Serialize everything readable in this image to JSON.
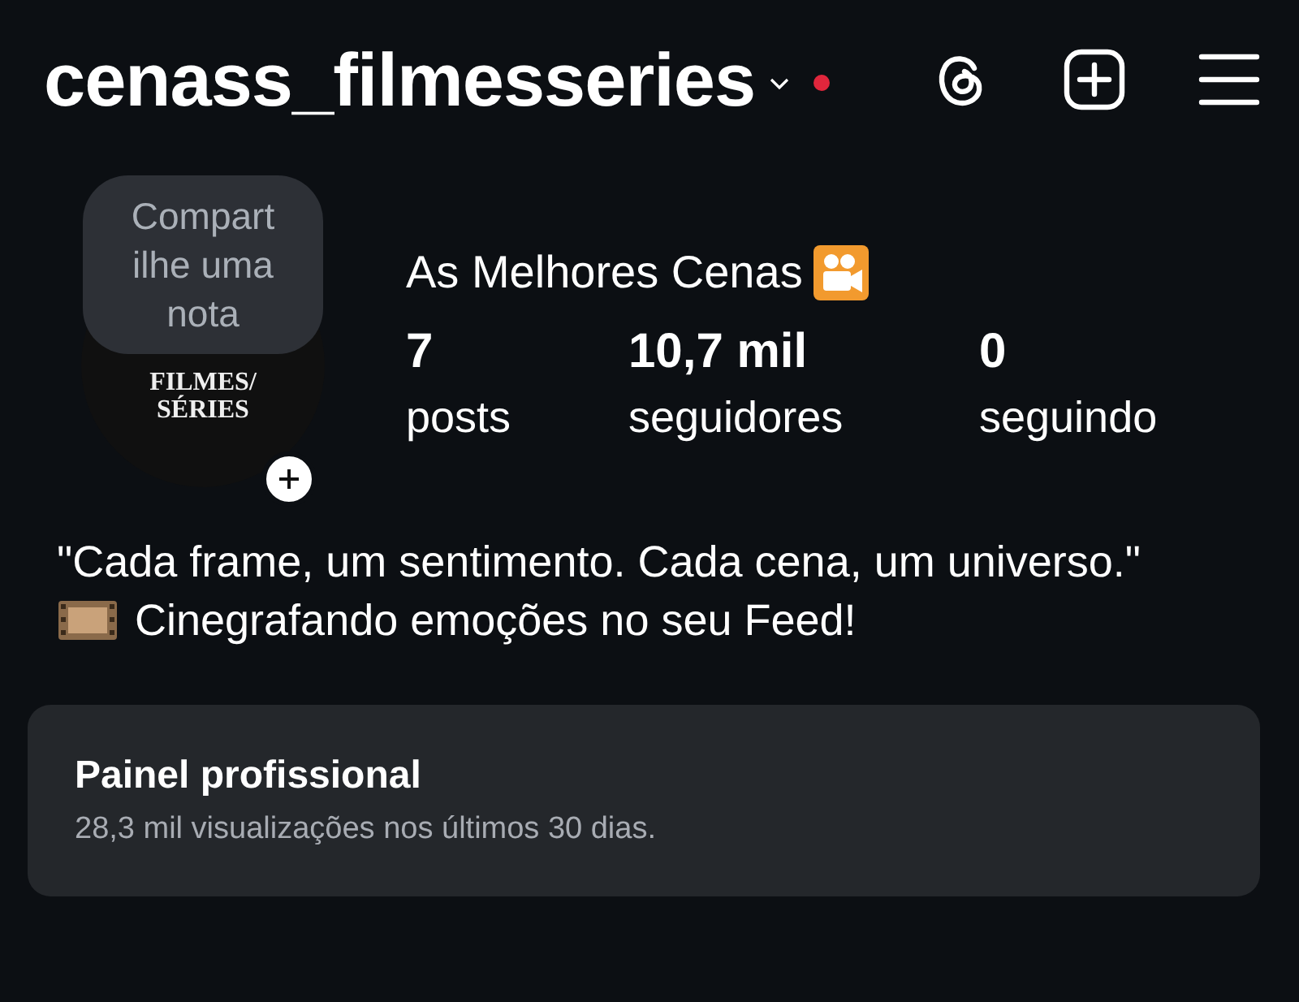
{
  "header": {
    "username": "cenass_filmesseries",
    "unread_dot": true
  },
  "note": {
    "text": "Compart ilhe uma nota"
  },
  "avatar": {
    "line_1": "FILMES/",
    "line_2": "SÉRIES"
  },
  "profile": {
    "display_name": "As Melhores Cenas"
  },
  "stats": [
    {
      "value": "7",
      "label": "posts"
    },
    {
      "value": "10,7 mil",
      "label": "seguidores"
    },
    {
      "value": "0",
      "label": "seguindo"
    }
  ],
  "bio": {
    "quote": "\"Cada frame, um sentimento. Cada cena, um universo.\"",
    "tagline": "Cinegrafando emoções no seu Feed!"
  },
  "dashboard": {
    "title": "Painel profissional",
    "subtitle": "28,3 mil visualizações nos últimos 30 dias."
  }
}
